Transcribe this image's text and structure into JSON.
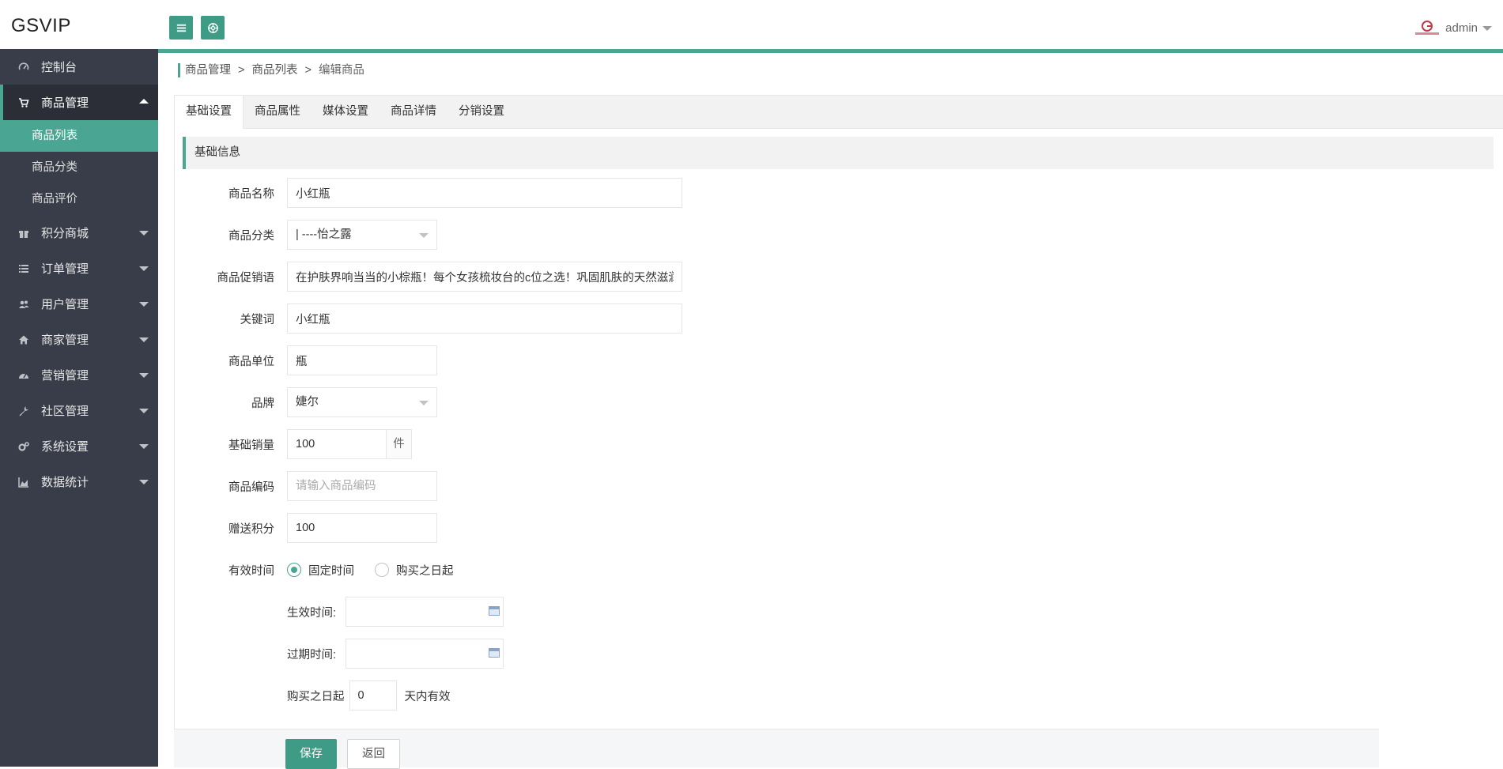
{
  "app": {
    "logo": "GSVIP",
    "user_name": "admin"
  },
  "colors": {
    "accent": "#4aa693",
    "sidebar_bg": "#393d49",
    "button": "#3e9b86"
  },
  "header": {
    "menu_icon": "hamburger-icon",
    "globe_icon": "globe-icon"
  },
  "sidebar": {
    "items": [
      {
        "label": "控制台",
        "icon": "dashboard-icon"
      },
      {
        "label": "商品管理",
        "icon": "cart-icon",
        "expanded": true,
        "children": [
          {
            "label": "商品列表",
            "active": true
          },
          {
            "label": "商品分类"
          },
          {
            "label": "商品评价"
          }
        ]
      },
      {
        "label": "积分商城",
        "icon": "gift-icon"
      },
      {
        "label": "订单管理",
        "icon": "list-icon"
      },
      {
        "label": "用户管理",
        "icon": "users-icon"
      },
      {
        "label": "商家管理",
        "icon": "home-icon"
      },
      {
        "label": "营销管理",
        "icon": "tachometer-icon"
      },
      {
        "label": "社区管理",
        "icon": "wrench-icon"
      },
      {
        "label": "系统设置",
        "icon": "cogs-icon"
      },
      {
        "label": "数据统计",
        "icon": "area-chart-icon"
      }
    ]
  },
  "breadcrumb": {
    "items": [
      "商品管理",
      "商品列表",
      "编辑商品"
    ],
    "separator": ">"
  },
  "tabs": [
    "基础设置",
    "商品属性",
    "媒体设置",
    "商品详情",
    "分销设置"
  ],
  "section_title": "基础信息",
  "form": {
    "name": {
      "label": "商品名称",
      "value": "小红瓶"
    },
    "category": {
      "label": "商品分类",
      "value": "| ----怡之露"
    },
    "promo": {
      "label": "商品促销语",
      "value": "在护肤界响当当的小棕瓶！每个女孩梳妆台的c位之选！巩固肌肤的天然滋润保护"
    },
    "keywords": {
      "label": "关键词",
      "value": "小红瓶"
    },
    "unit": {
      "label": "商品单位",
      "value": "瓶"
    },
    "brand": {
      "label": "品牌",
      "value": "婕尔"
    },
    "base_sales": {
      "label": "基础销量",
      "value": "100",
      "suffix": "件"
    },
    "code": {
      "label": "商品编码",
      "value": "",
      "placeholder": "请输入商品编码"
    },
    "points": {
      "label": "赠送积分",
      "value": "100"
    },
    "validity": {
      "label": "有效时间",
      "options": [
        "固定时间",
        "购买之日起"
      ],
      "selected": 0,
      "start_label": "生效时间:",
      "start_value": "",
      "end_label": "过期时间:",
      "end_value": "",
      "days_prefix": "购买之日起",
      "days_value": "0",
      "days_suffix": "天内有效"
    }
  },
  "actions": {
    "save": "保存",
    "back": "返回"
  }
}
